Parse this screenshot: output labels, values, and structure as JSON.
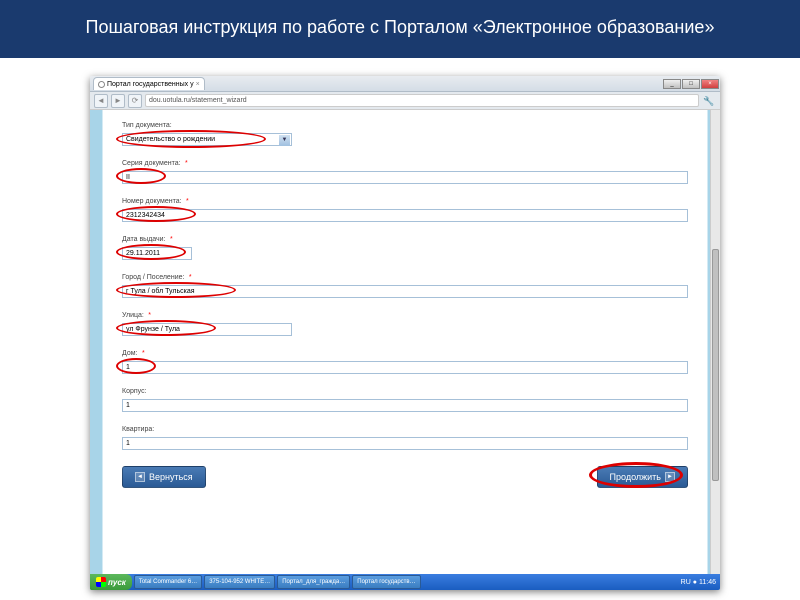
{
  "slide": {
    "title": "Пошаговая инструкция по работе с Порталом «Электронное образование»"
  },
  "browser": {
    "tab_title": "Портал государственных у",
    "url": "dou.uotula.ru/statement_wizard"
  },
  "form": {
    "doc_type_label": "Тип документа:",
    "doc_type_value": "Свидетельство о рождении",
    "series_label": "Серия документа:",
    "series_value": "II",
    "number_label": "Номер документа:",
    "number_value": "2312342434",
    "issue_date_label": "Дата выдачи:",
    "issue_date_value": "29.11.2011",
    "city_label": "Город / Поселение:",
    "city_value": "г Тула / обл Тульская",
    "street_label": "Улица:",
    "street_value": "ул Фрунзе / Тула",
    "house_label": "Дом:",
    "house_value": "1",
    "block_label": "Корпус:",
    "block_value": "1",
    "apt_label": "Квартира:",
    "apt_value": "1",
    "required_mark": "*"
  },
  "buttons": {
    "back": "Вернуться",
    "next": "Продолжить"
  },
  "taskbar": {
    "start": "пуск",
    "items": [
      "Total Commander 6…",
      "375-104-952 WHITE…",
      "Портал_для_гражда…",
      "Портал государств…"
    ],
    "lang": "RU",
    "time": "11:46"
  }
}
